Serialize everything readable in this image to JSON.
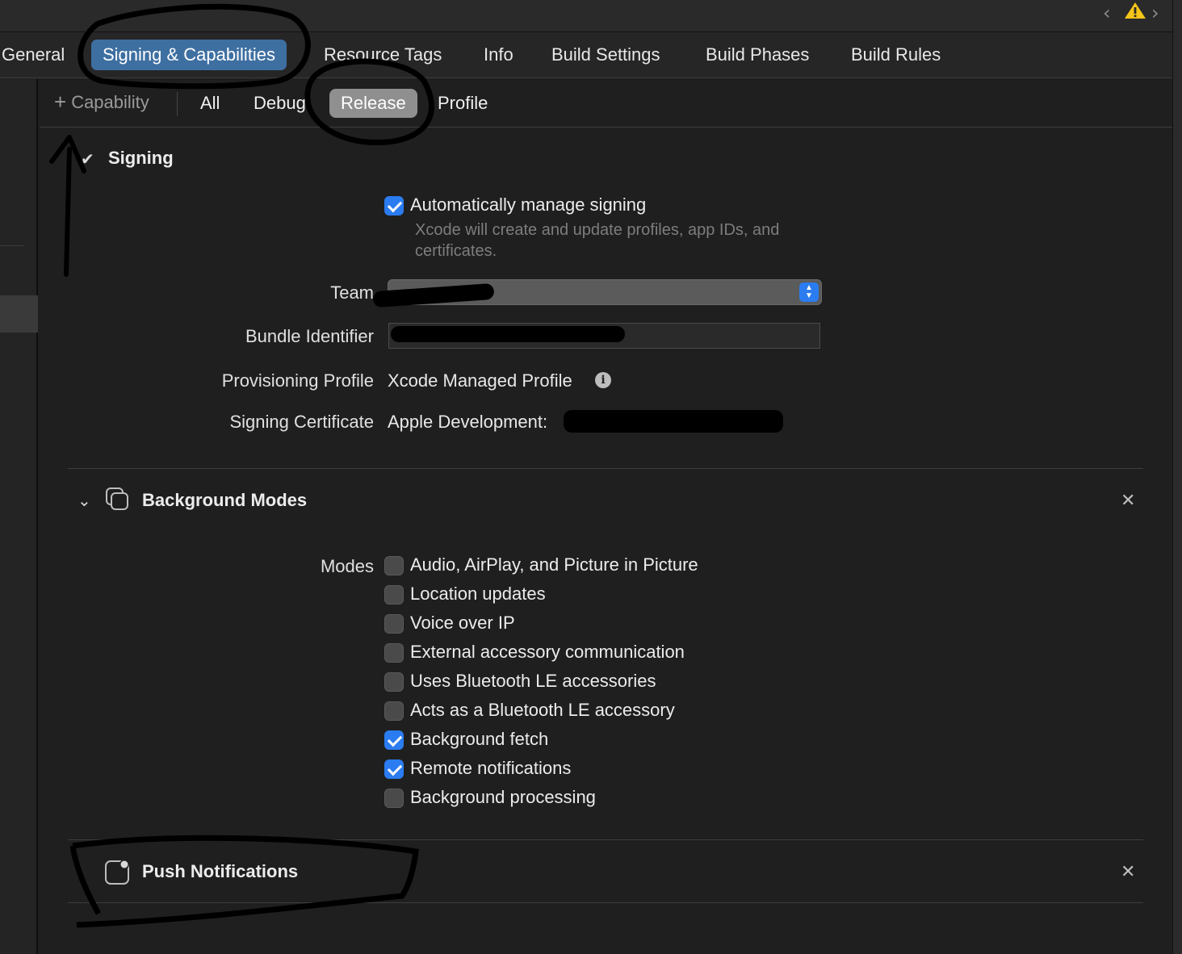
{
  "editor_tabs": [
    {
      "label": "General",
      "active": false
    },
    {
      "label": "Signing & Capabilities",
      "active": true
    },
    {
      "label": "Resource Tags",
      "active": false
    },
    {
      "label": "Info",
      "active": false
    },
    {
      "label": "Build Settings",
      "active": false
    },
    {
      "label": "Build Phases",
      "active": false
    },
    {
      "label": "Build Rules",
      "active": false
    }
  ],
  "toolbar": {
    "nav_back_icon": "chevron-left-icon",
    "nav_forward_icon": "chevron-right-icon",
    "warning_icon": "warning-triangle-icon"
  },
  "subbar": {
    "add_capability_label": "Capability",
    "configs": [
      {
        "label": "All",
        "active": false
      },
      {
        "label": "Debug",
        "active": false
      },
      {
        "label": "Release",
        "active": true
      },
      {
        "label": "Profile",
        "active": false
      }
    ]
  },
  "signing": {
    "title": "Signing",
    "auto_manage_label": "Automatically manage signing",
    "auto_manage_checked": true,
    "auto_manage_hint": "Xcode will create and update profiles, app IDs, and certificates.",
    "team_label": "Team",
    "team_value": "",
    "bundle_id_label": "Bundle Identifier",
    "bundle_id_value": "",
    "provisioning_label": "Provisioning Profile",
    "provisioning_value": "Xcode Managed Profile",
    "certificate_label": "Signing Certificate",
    "certificate_value": "Apple Development:"
  },
  "background_modes": {
    "title": "Background Modes",
    "modes_label": "Modes",
    "modes": [
      {
        "label": "Audio, AirPlay, and Picture in Picture",
        "checked": false
      },
      {
        "label": "Location updates",
        "checked": false
      },
      {
        "label": "Voice over IP",
        "checked": false
      },
      {
        "label": "External accessory communication",
        "checked": false
      },
      {
        "label": "Uses Bluetooth LE accessories",
        "checked": false
      },
      {
        "label": "Acts as a Bluetooth LE accessory",
        "checked": false
      },
      {
        "label": "Background fetch",
        "checked": true
      },
      {
        "label": "Remote notifications",
        "checked": true
      },
      {
        "label": "Background processing",
        "checked": false
      }
    ]
  },
  "push_notifications": {
    "title": "Push Notifications"
  },
  "colors": {
    "accent": "#2b7cf0",
    "active_tab": "#3e6fa1",
    "active_segment": "#8f8f8f",
    "background": "#1f1f1f",
    "warning": "#f5c518"
  }
}
